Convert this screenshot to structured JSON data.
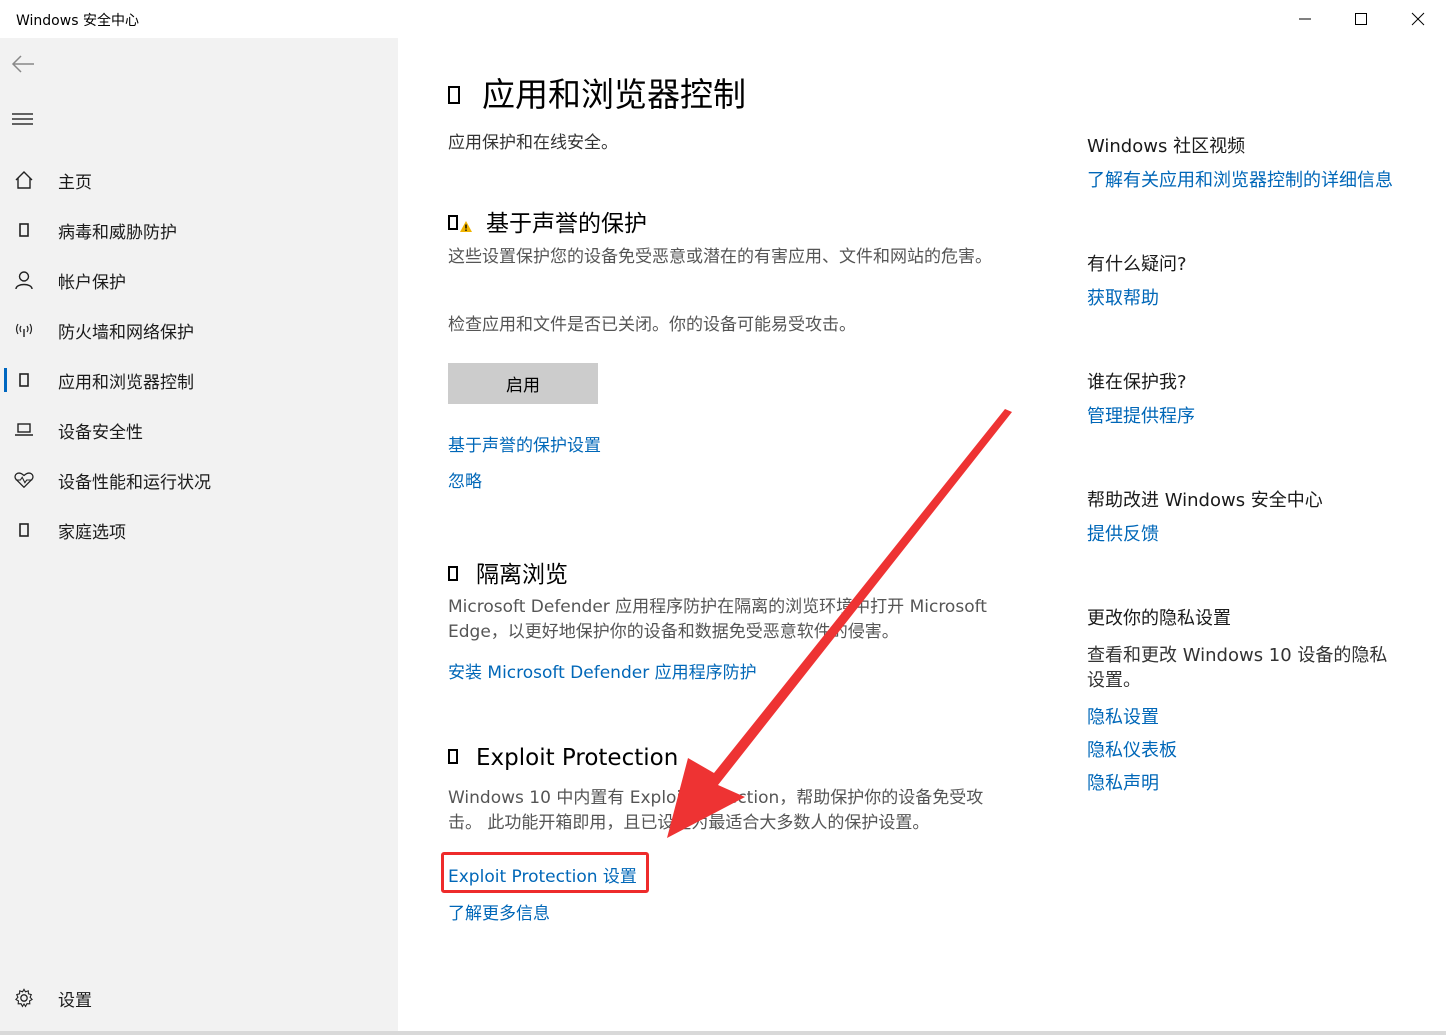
{
  "window": {
    "title": "Windows 安全中心"
  },
  "sidebar": {
    "items": [
      {
        "label": "主页",
        "icon": "home-icon"
      },
      {
        "label": "病毒和威胁防护",
        "icon": "shield-icon"
      },
      {
        "label": "帐户保护",
        "icon": "person-icon"
      },
      {
        "label": "防火墙和网络保护",
        "icon": "wireless-icon"
      },
      {
        "label": "应用和浏览器控制",
        "icon": "app-browser-icon",
        "active": true
      },
      {
        "label": "设备安全性",
        "icon": "laptop-icon"
      },
      {
        "label": "设备性能和运行状况",
        "icon": "heart-pulse-icon"
      },
      {
        "label": "家庭选项",
        "icon": "family-icon"
      }
    ],
    "settings_label": "设置"
  },
  "main": {
    "title": "应用和浏览器控制",
    "subtitle": "应用保护和在线安全。",
    "reputation": {
      "title": "基于声誉的保护",
      "desc": "这些设置保护您的设备免受恶意或潜在的有害应用、文件和网站的危害。",
      "status": "检查应用和文件是否已关闭。你的设备可能易受攻击。",
      "enable_button": "启用",
      "settings_link": "基于声誉的保护设置",
      "ignore_link": "忽略"
    },
    "isolated": {
      "title": "隔离浏览",
      "desc": "Microsoft Defender 应用程序防护在隔离的浏览环境中打开 Microsoft Edge，以更好地保护你的设备和数据免受恶意软件的侵害。",
      "install_link": "安装 Microsoft Defender 应用程序防护"
    },
    "exploit": {
      "title": "Exploit Protection",
      "desc": "Windows 10 中内置有 Exploit Protection，帮助保护你的设备免受攻击。 此功能开箱即用，且已设定为最适合大多数人的保护设置。",
      "settings_link": "Exploit Protection 设置",
      "more_link": "了解更多信息"
    }
  },
  "right": {
    "community": {
      "heading": "Windows 社区视频",
      "link": "了解有关应用和浏览器控制的详细信息"
    },
    "question": {
      "heading": "有什么疑问?",
      "link": "获取帮助"
    },
    "who": {
      "heading": "谁在保护我?",
      "link": "管理提供程序"
    },
    "improve": {
      "heading": "帮助改进 Windows 安全中心",
      "link": "提供反馈"
    },
    "privacy": {
      "heading": "更改你的隐私设置",
      "desc": "查看和更改 Windows 10 设备的隐私设置。",
      "links": [
        "隐私设置",
        "隐私仪表板",
        "隐私声明"
      ]
    }
  },
  "colors": {
    "accent": "#0067b8",
    "annotation": "#ee2b2b",
    "sidebar_bg": "#f2f2f2",
    "button_bg": "#cccccc"
  }
}
